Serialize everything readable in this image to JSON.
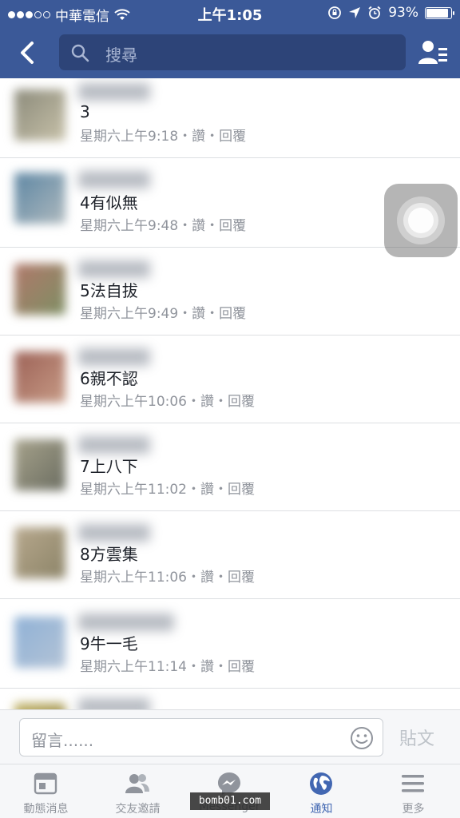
{
  "status_bar": {
    "carrier": "中華電信",
    "time": "上午1:05",
    "battery": "93%",
    "battery_level": 0.93
  },
  "nav": {
    "search_placeholder": "搜尋"
  },
  "comments": [
    {
      "text": "3",
      "meta": "星期六上午9:18・讚・回覆"
    },
    {
      "text": "4有似無",
      "meta": "星期六上午9:48・讚・回覆"
    },
    {
      "text": "5法自拔",
      "meta": "星期六上午9:49・讚・回覆"
    },
    {
      "text": "6親不認",
      "meta": "星期六上午10:06・讚・回覆"
    },
    {
      "text": "7上八下",
      "meta": "星期六上午11:02・讚・回覆"
    },
    {
      "text": "8方雲集",
      "meta": "星期六上午11:06・讚・回覆"
    },
    {
      "text": "9牛一毛",
      "meta": "星期六上午11:14・讚・回覆"
    }
  ],
  "composer": {
    "placeholder": "留言......",
    "post_label": "貼文"
  },
  "tabs": [
    {
      "label": "動態消息",
      "icon": "news-feed-icon"
    },
    {
      "label": "交友邀請",
      "icon": "friend-requests-icon"
    },
    {
      "label": "Messenger",
      "icon": "messenger-icon"
    },
    {
      "label": "通知",
      "icon": "globe-icon"
    },
    {
      "label": "更多",
      "icon": "menu-icon"
    }
  ],
  "watermark": "bomb01.com",
  "colors": {
    "brand": "#3b5998",
    "active_tab": "#4267b2",
    "meta_text": "#90949c"
  }
}
